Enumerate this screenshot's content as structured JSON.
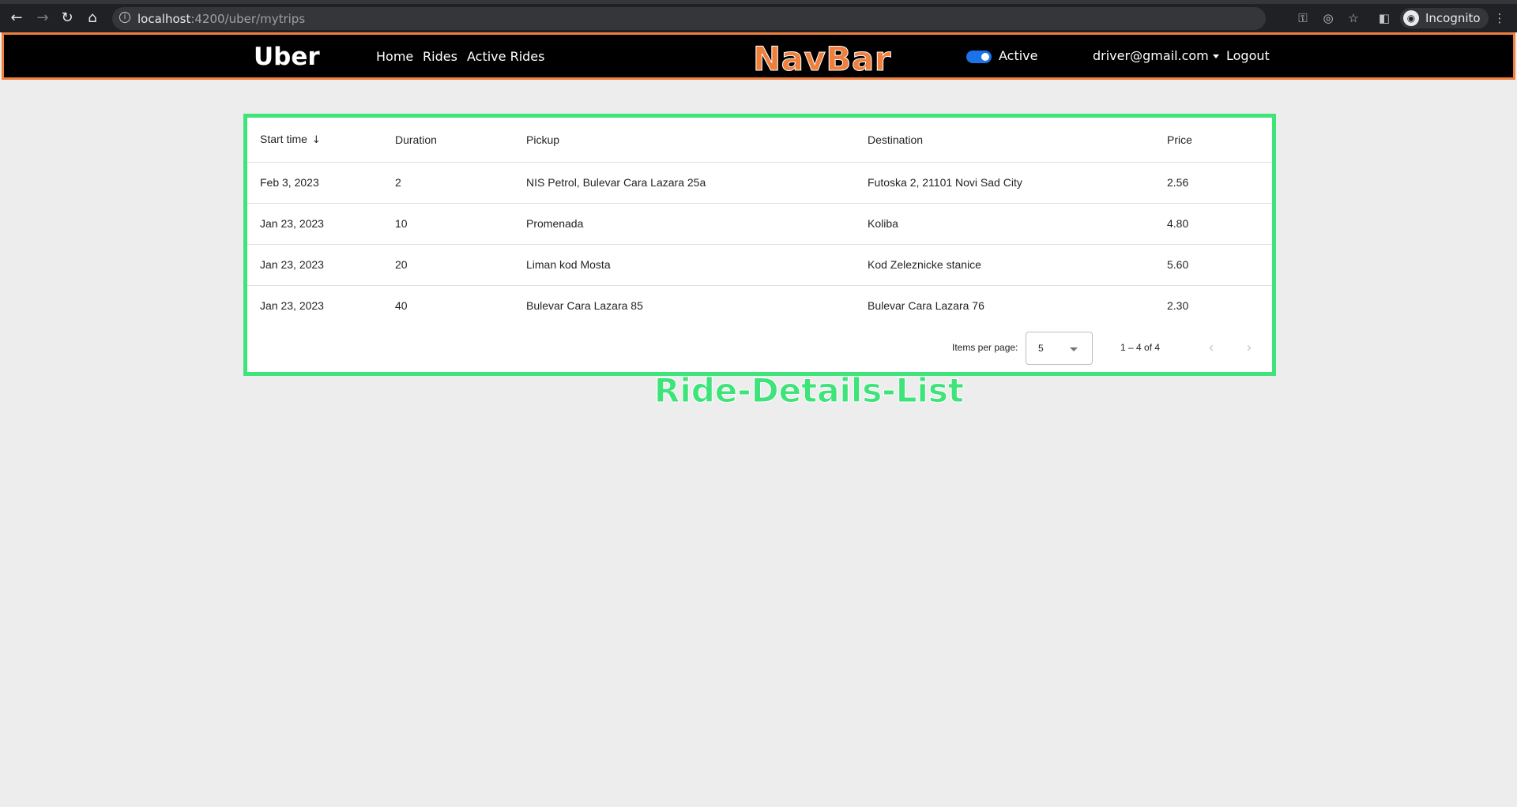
{
  "browser": {
    "url_host": "localhost",
    "url_path": ":4200/uber/mytrips",
    "profile_label": "Incognito"
  },
  "navbar": {
    "brand": "Uber",
    "links": [
      "Home",
      "Rides",
      "Active Rides"
    ],
    "active_label": "Active",
    "active_on": true,
    "user_email": "driver@gmail.com",
    "logout_label": "Logout",
    "annotation": "NavBar",
    "annotation_color": "#f07f3c"
  },
  "ride_list": {
    "annotation": "Ride-Details-List",
    "annotation_color": "#3ee37a",
    "columns": [
      "Start time",
      "Duration",
      "Pickup",
      "Destination",
      "Price"
    ],
    "rows": [
      [
        "Feb 3, 2023",
        "2",
        "NIS Petrol, Bulevar Cara Lazara 25a",
        "Futoska 2, 21101 Novi Sad City",
        "2.56"
      ],
      [
        "Jan 23, 2023",
        "10",
        "Promenada",
        "Koliba",
        "4.80"
      ],
      [
        "Jan 23, 2023",
        "20",
        "Liman kod Mosta",
        "Kod Zeleznicke stanice",
        "5.60"
      ],
      [
        "Jan 23, 2023",
        "40",
        "Bulevar Cara Lazara 85",
        "Bulevar Cara Lazara 76",
        "2.30"
      ]
    ],
    "paginator": {
      "items_per_page_label": "Items per page:",
      "page_size": "5",
      "range": "1 – 4 of 4"
    }
  }
}
